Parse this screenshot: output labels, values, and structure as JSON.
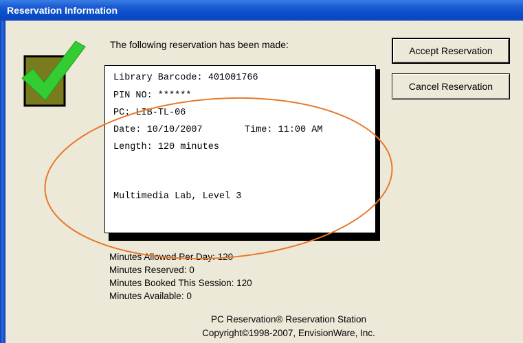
{
  "window": {
    "title": "Reservation Information"
  },
  "intro": "The following reservation has been made:",
  "receipt": {
    "barcode": "Library Barcode: 401001766",
    "pin": "PIN NO: ******",
    "pc": "PC: LIB-TL-06",
    "date": "Date: 10/10/2007",
    "time": "Time: 11:00 AM",
    "length": "Length: 120 minutes",
    "location": "Multimedia Lab, Level 3"
  },
  "buttons": {
    "accept": "Accept Reservation",
    "cancel": "Cancel Reservation"
  },
  "stats": {
    "allowed": "Minutes Allowed Per Day: 120",
    "reserved": "Minutes Reserved: 0",
    "booked": "Minutes Booked This Session: 120",
    "available": "Minutes Available: 0"
  },
  "footer": {
    "product": "PC Reservation® Reservation Station",
    "copyright": "Copyright©1998-2007, EnvisionWare, Inc."
  },
  "colors": {
    "titlebar": "#0a46c0",
    "window_bg": "#ece9d8",
    "checkmark": "#33cc33",
    "checkbox_fill": "#7a7a1e",
    "annotation": "#e8782a"
  },
  "icons": {
    "status": "green-checkmark-icon"
  }
}
